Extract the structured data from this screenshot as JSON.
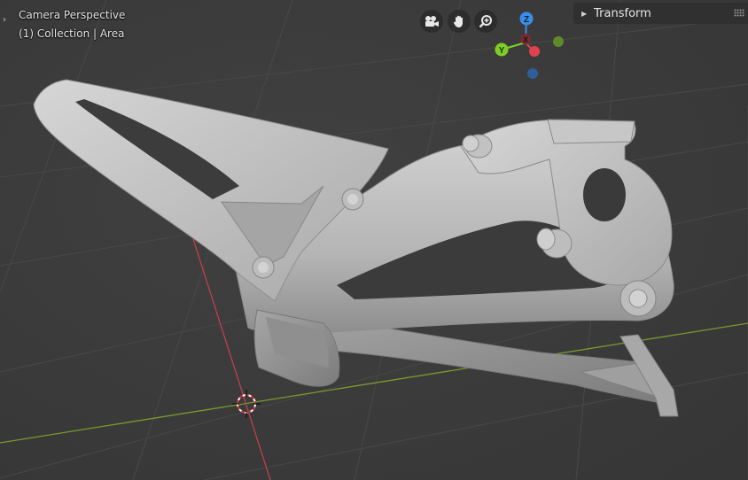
{
  "viewport": {
    "view_name": "Camera Perspective",
    "collection_label": "(1) Collection | Area",
    "background_color": "#3c3c3c",
    "grid_color": "#444444",
    "x_axis_color": "#c0404a",
    "y_axis_color": "#7a9a2c"
  },
  "navigation": {
    "camera_icon": "camera-view-icon",
    "pan_icon": "hand-pan-icon",
    "zoom_icon": "zoom-icon"
  },
  "gizmo": {
    "z_label": "Z",
    "y_label": "Y",
    "x_label": "X",
    "x_color": "#e0414f",
    "y_color": "#7dcf26",
    "z_color": "#3a8ee6"
  },
  "sidebar": {
    "panel_title": "Transform",
    "collapse_icon": "triangle-right-icon",
    "grip_icon": "drag-grip-icon"
  },
  "model": {
    "material_color": "#b9b9b9"
  }
}
